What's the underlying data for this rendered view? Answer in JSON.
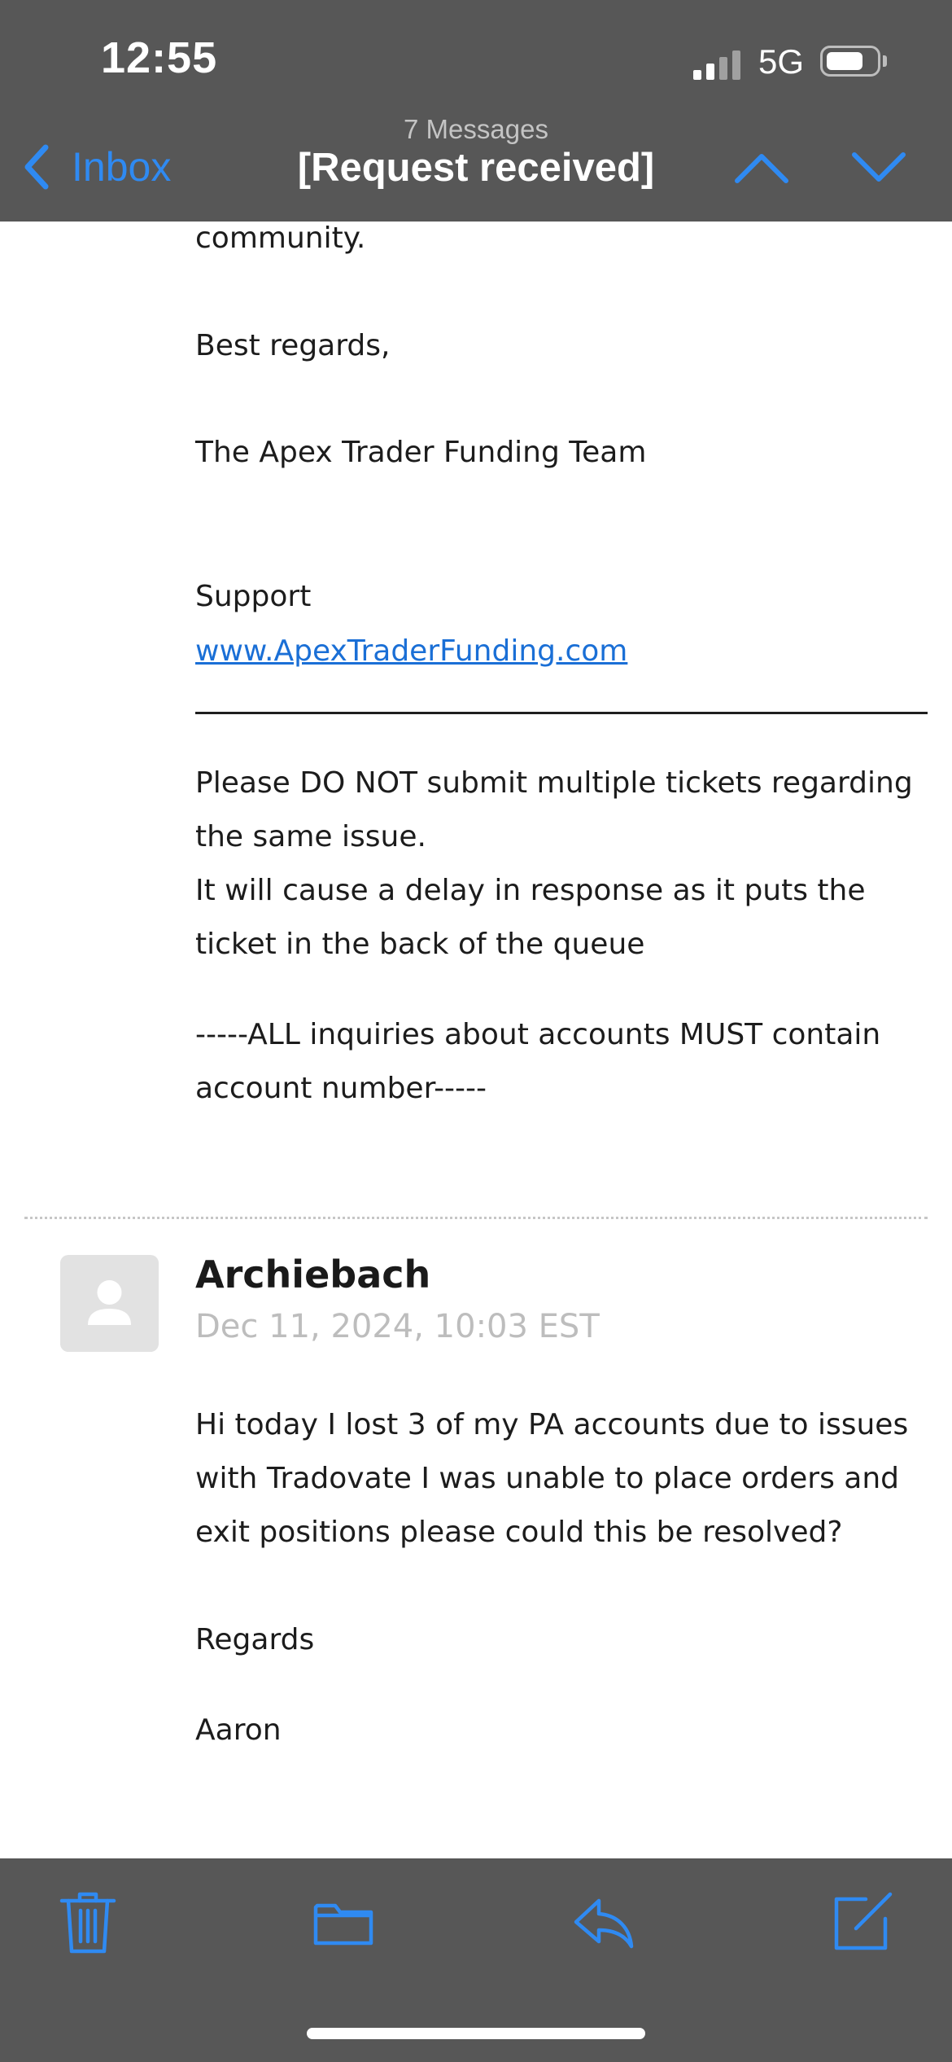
{
  "status_bar": {
    "time": "12:55",
    "network": "5G"
  },
  "nav": {
    "back_label": "Inbox",
    "message_count": "7 Messages",
    "subject": "[Request received]"
  },
  "previous_message": {
    "lines": [
      "community.",
      "Best regards,",
      "The Apex Trader Funding Team",
      "Support"
    ],
    "link": "www.ApexTraderFunding.com",
    "notice_lines": [
      "Please DO NOT submit multiple tickets regarding",
      "the same issue.",
      "It will cause a delay in response as it puts the",
      "ticket in the back of the queue",
      "-----ALL inquiries about accounts MUST contain",
      "account number-----"
    ]
  },
  "message": {
    "sender": "Archiebach",
    "date": "Dec 11, 2024, 10:03 EST",
    "body_lines": [
      "Hi today I lost 3 of my PA accounts due to issues",
      "with Tradovate I was unable to place orders and",
      "exit positions please could this be resolved?",
      "Regards",
      "Aaron"
    ]
  },
  "toolbar": {
    "icons": [
      "trash-icon",
      "folder-icon",
      "reply-icon",
      "compose-icon"
    ]
  },
  "colors": {
    "accent": "#2f8af2",
    "header_bg": "#575757",
    "link": "#1a6fd6"
  }
}
